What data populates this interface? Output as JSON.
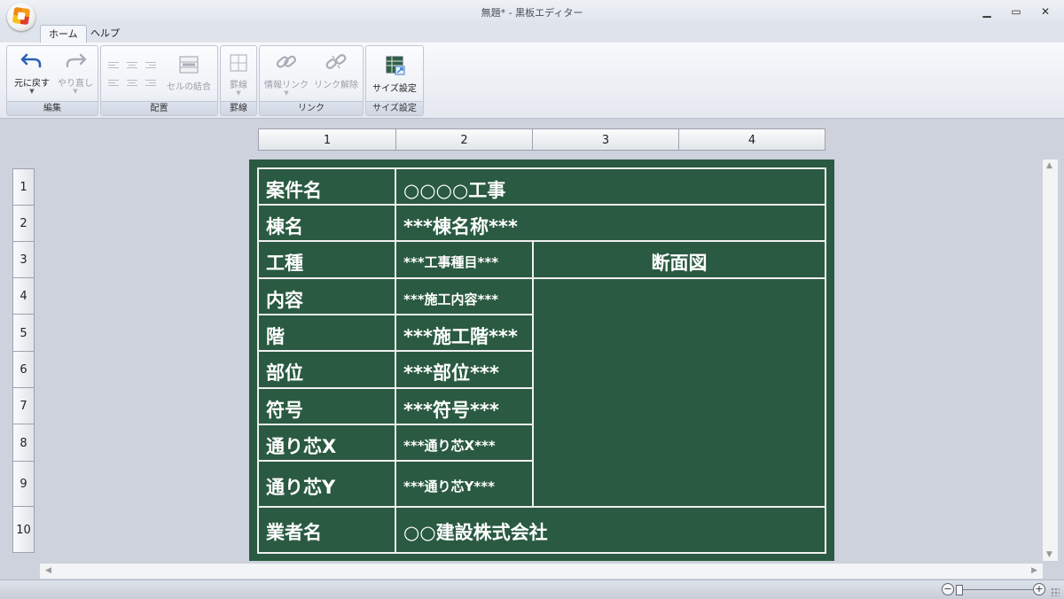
{
  "window": {
    "title": "無題* - 黒板エディター",
    "controls": {
      "minimize": "▁",
      "maximize": "▭",
      "close": "✕"
    }
  },
  "tabs": [
    {
      "label": "ホーム",
      "active": true
    },
    {
      "label": "ヘルプ",
      "active": false
    }
  ],
  "ribbon": {
    "groups": [
      {
        "label": "編集",
        "buttons": [
          {
            "label": "元に戻す",
            "icon": "undo-arrow-icon",
            "enabled": true
          },
          {
            "label": "やり直し",
            "icon": "redo-arrow-icon",
            "enabled": false
          }
        ]
      },
      {
        "label": "配置",
        "buttons": [
          {
            "label": "セルの結合",
            "icon": "merge-cells-icon",
            "enabled": false
          }
        ]
      },
      {
        "label": "罫線",
        "buttons": [
          {
            "label": "罫線",
            "icon": "borders-icon",
            "enabled": false
          }
        ]
      },
      {
        "label": "リンク",
        "buttons": [
          {
            "label": "情報リンク",
            "icon": "link-icon",
            "enabled": false
          },
          {
            "label": "リンク解除",
            "icon": "unlink-icon",
            "enabled": false
          }
        ]
      },
      {
        "label": "サイズ設定",
        "buttons": [
          {
            "label": "サイズ設定",
            "icon": "size-settings-icon",
            "enabled": true
          }
        ]
      }
    ]
  },
  "column_headers": [
    "1",
    "2",
    "3",
    "4"
  ],
  "row_headers": [
    "1",
    "2",
    "3",
    "4",
    "5",
    "6",
    "7",
    "8",
    "9",
    "10"
  ],
  "board": {
    "background": "#2a5a41",
    "line_color": "#f0f0f0",
    "rows": [
      {
        "label": "案件名",
        "value": "○○○○工事"
      },
      {
        "label": "棟名",
        "value": "***棟名称***"
      },
      {
        "label": "工種",
        "value": "***工事種目***"
      },
      {
        "label": "内容",
        "value": "***施工内容***"
      },
      {
        "label": "階",
        "value": "***施工階***"
      },
      {
        "label": "部位",
        "value": "***部位***"
      },
      {
        "label": "符号",
        "value": "***符号***"
      },
      {
        "label": "通り芯X",
        "value": "***通り芯X***"
      },
      {
        "label": "通り芯Y",
        "value": "***通り芯Y***"
      },
      {
        "label": "業者名",
        "value": "○○建設株式会社"
      }
    ],
    "section_title": "断面図"
  },
  "statusbar": {
    "zoom_out": "−",
    "zoom_in": "+"
  }
}
